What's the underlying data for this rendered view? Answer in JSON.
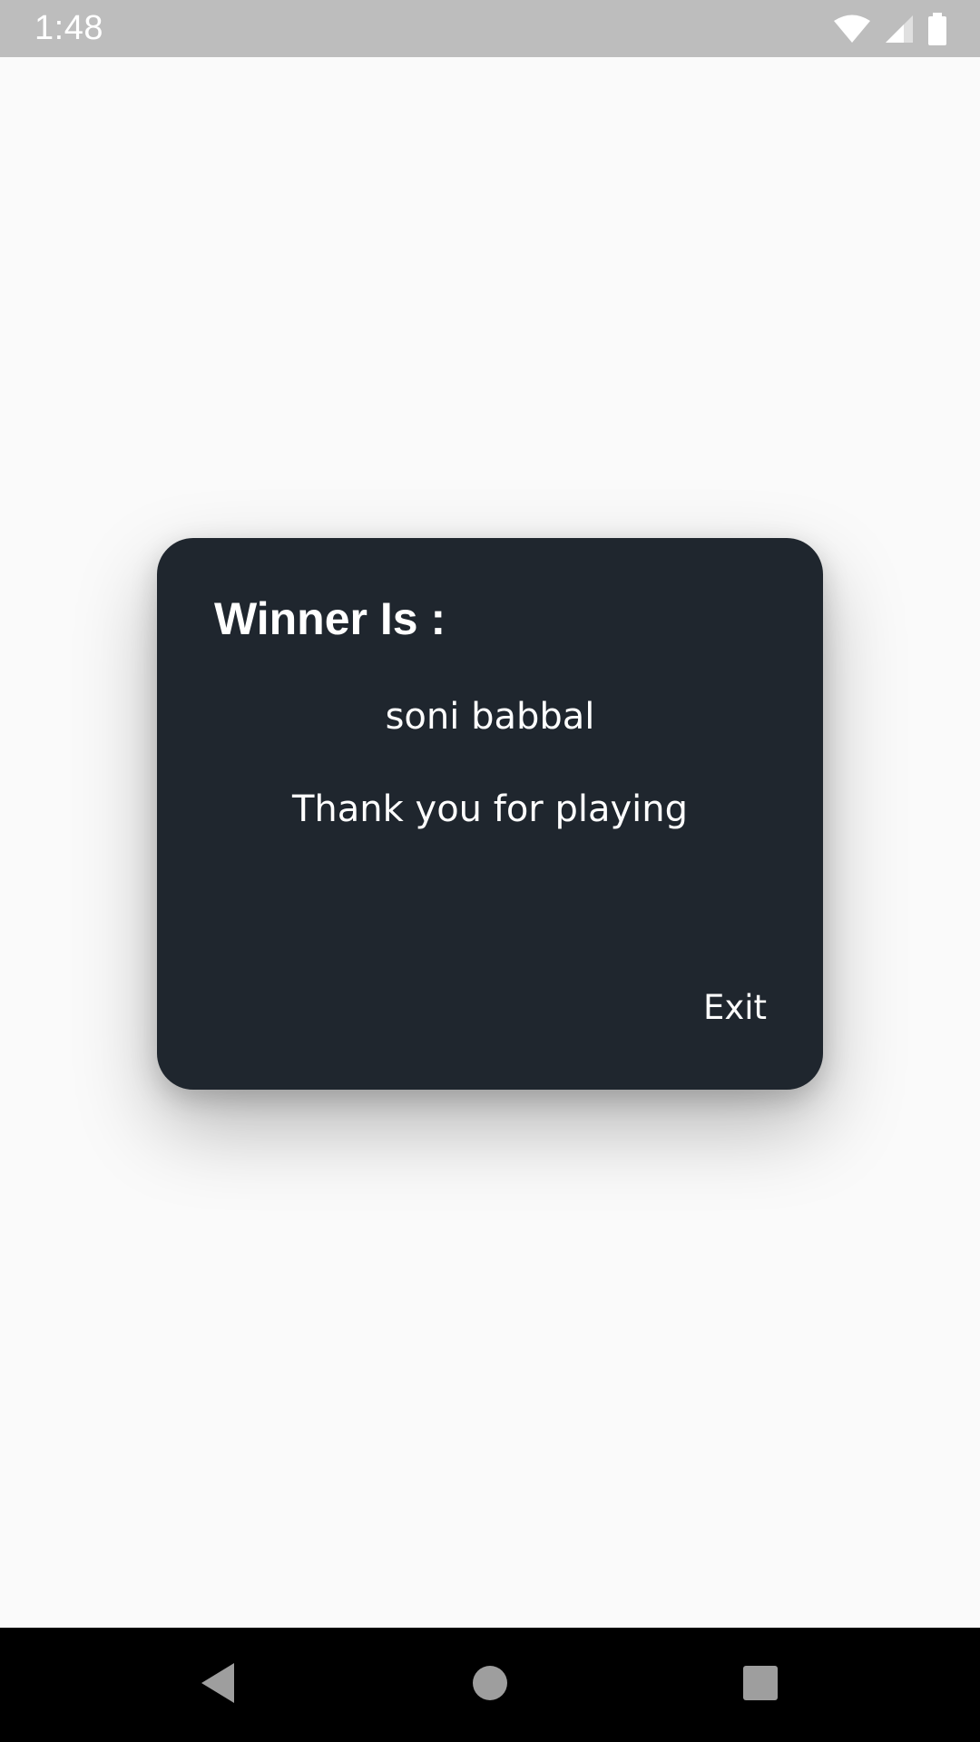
{
  "status_bar": {
    "time": "1:48",
    "icons": [
      "wifi-icon",
      "cell-signal-icon",
      "battery-icon"
    ]
  },
  "dialog": {
    "title": "Winner Is :",
    "winner_name": "soni babbal",
    "message": "Thank you for playing",
    "exit_label": "Exit"
  },
  "nav_bar": {
    "icons": [
      "back-icon",
      "home-icon",
      "recents-icon"
    ]
  },
  "colors": {
    "status_bar_bg": "#bdbdbd",
    "page_bg": "#fafafa",
    "dialog_bg": "#1f262e",
    "text": "#ffffff",
    "nav_bar_bg": "#000000",
    "nav_icon": "#9e9e9e"
  }
}
